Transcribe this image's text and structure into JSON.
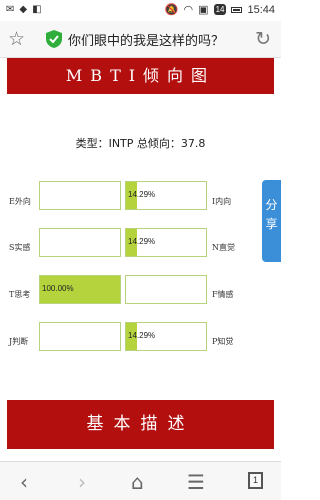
{
  "status_bar": {
    "sim_badge": "4G",
    "badge_num": "14",
    "time": "15:44"
  },
  "browser": {
    "page_title": "你们眼中的我是这样的吗？"
  },
  "header": {
    "title": "MBTI倾向图"
  },
  "summary": {
    "text": "类型：INTP 总倾向：37.8"
  },
  "rows": [
    {
      "left_label": "E外向",
      "left_value": "",
      "left_fill": 0,
      "right_value": "14.29%",
      "right_fill": 14.29,
      "right_label": "I内向"
    },
    {
      "left_label": "S实感",
      "left_value": "",
      "left_fill": 0,
      "right_value": "14.29%",
      "right_fill": 14.29,
      "right_label": "N直觉"
    },
    {
      "left_label": "T思考",
      "left_value": "100.00%",
      "left_fill": 100,
      "right_value": "",
      "right_fill": 0,
      "right_label": "F情感"
    },
    {
      "left_label": "J判断",
      "left_value": "",
      "left_fill": 0,
      "right_value": "14.29%",
      "right_fill": 14.29,
      "right_label": "P知觉"
    }
  ],
  "share_label": "分享",
  "section": {
    "title": "基本描述"
  },
  "nav": {
    "tabs_count": "1"
  },
  "colors": {
    "accent": "#b30f0f",
    "bar": "#b5d33d",
    "border": "#b7d37b",
    "share": "#3b8fd9"
  }
}
